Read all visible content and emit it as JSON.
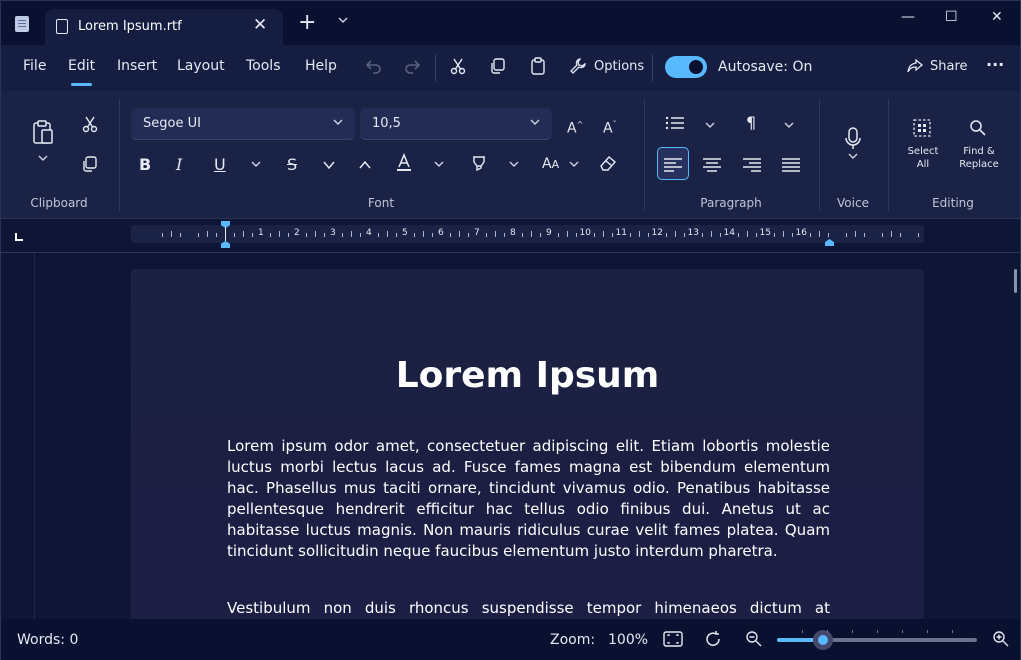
{
  "titlebar": {
    "tab_title": "Lorem Ipsum.rtf",
    "tab_close": "✕",
    "new_tab": "+",
    "tab_menu": "⌄",
    "minimize": "—",
    "maximize": "☐",
    "close": "✕"
  },
  "menubar": {
    "items": [
      {
        "label": "File"
      },
      {
        "label": "Edit",
        "active": true
      },
      {
        "label": "Insert"
      },
      {
        "label": "Layout"
      },
      {
        "label": "Tools"
      },
      {
        "label": "Help"
      }
    ],
    "options_label": "Options",
    "autosave_label": "Autosave: On",
    "autosave_on": true,
    "share_label": "Share",
    "more": "···"
  },
  "ribbon": {
    "font_name": "Segoe UI",
    "font_size": "10,5",
    "groups": [
      "Clipboard",
      "Font",
      "Paragraph",
      "Voice",
      "Editing"
    ],
    "select_all": "Select All",
    "find_replace": "Find & Replace",
    "active_alignment": "align-left",
    "accent_color": "#58b9ff"
  },
  "ruler": {
    "corner": "L",
    "numbers": [
      "1",
      "2",
      "3",
      "4",
      "5",
      "6",
      "7",
      "8",
      "9",
      "10",
      "11",
      "12",
      "13",
      "14",
      "15",
      "16"
    ]
  },
  "document": {
    "title": "Lorem Ipsum",
    "paragraphs": [
      "Lorem ipsum odor amet, consectetuer adipiscing elit. Etiam lobortis molestie luctus morbi lectus lacus ad. Fusce fames magna est bibendum elementum hac. Phasellus mus taciti ornare, tincidunt vivamus odio. Penatibus habitasse pellentesque hendrerit efficitur hac tellus odio finibus dui. Anetus ut ac habitasse luctus magnis. Non mauris ridiculus curae velit fames platea. Quam tincidunt sollicitudin neque faucibus elementum justo interdum pharetra.",
      "Vestibulum non duis rhoncus suspendisse tempor himenaeos dictum at"
    ]
  },
  "status": {
    "words": "Words: 0",
    "zoom_label": "Zoom:",
    "zoom_value": "100%",
    "zoom_level": 0.23
  }
}
